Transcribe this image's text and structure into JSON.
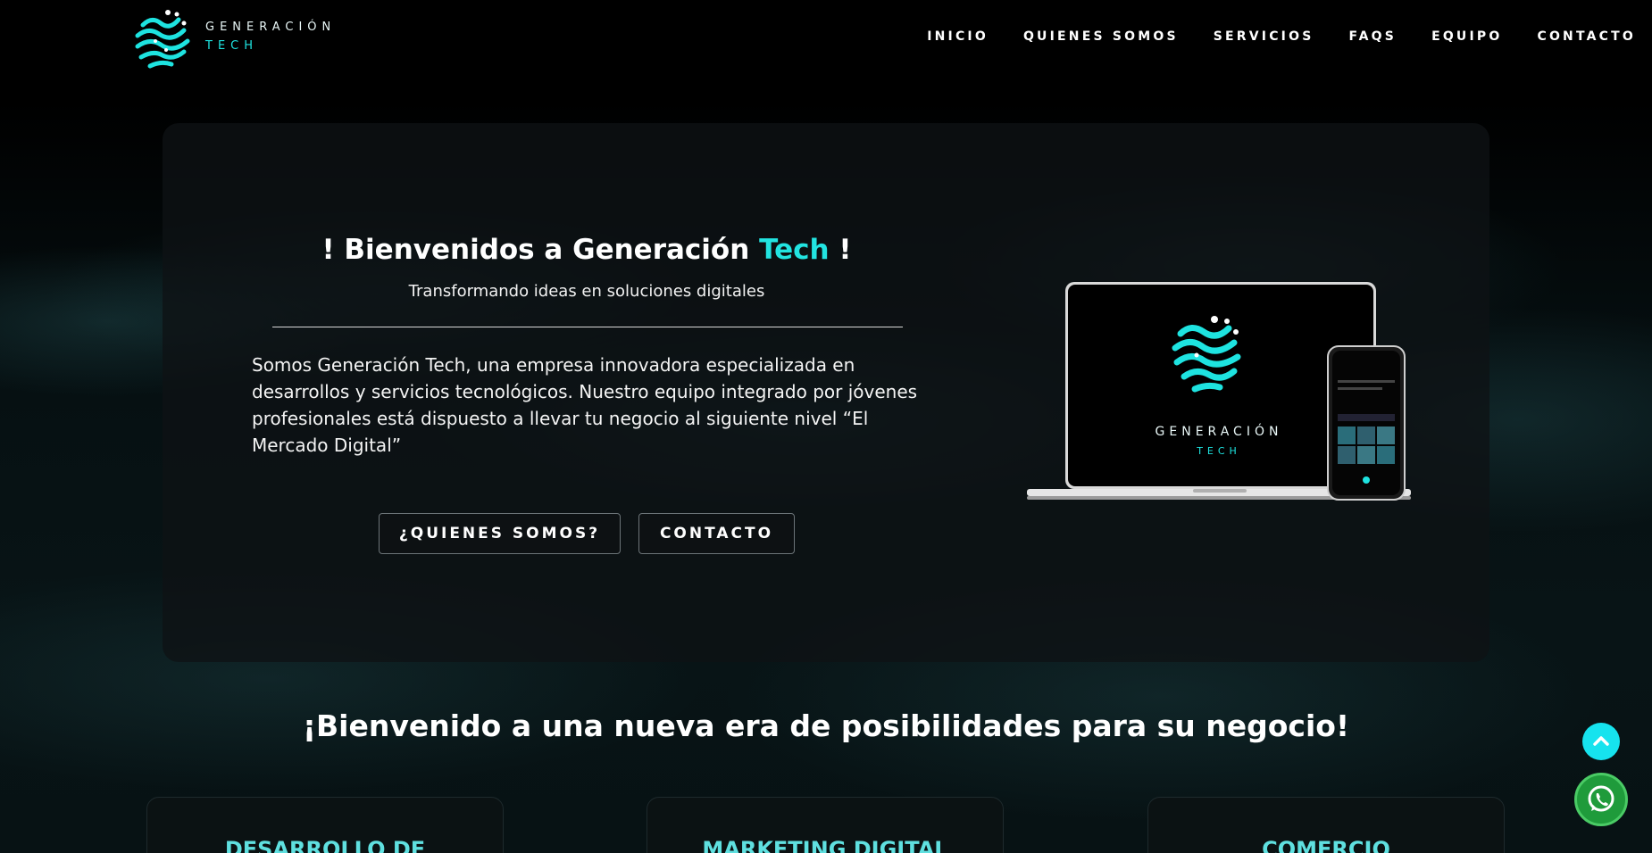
{
  "brand": {
    "line1": "GENERACIÓN",
    "line2": "TECH",
    "accent_color": "#1ee3e0"
  },
  "nav": {
    "items": [
      "INICIO",
      "QUIENES SOMOS",
      "SERVICIOS",
      "FAQS",
      "EQUIPO",
      "CONTACTO"
    ]
  },
  "hero": {
    "title_prefix": "! Bienvenidos a Generación",
    "title_accent": "Tech",
    "title_suffix": "!",
    "subtitle": "Transformando ideas en soluciones digitales",
    "body": "Somos Generación Tech, una empresa innovadora especializada en desarrollos y servicios tecnológicos. Nuestro equipo integrado por jóvenes profesionales está dispuesto a llevar tu negocio al siguiente nivel “El Mercado Digital”",
    "btn_quienes": "¿QUIENES SOMOS?",
    "btn_contacto": "CONTACTO",
    "device_logo_line1": "GENERACIÓN",
    "device_logo_line2": "TECH"
  },
  "section": {
    "title": "¡Bienvenido a una nueva era de posibilidades para su negocio!"
  },
  "services": [
    {
      "title": "DESARROLLO DE"
    },
    {
      "title": "MARKETING DIGITAL"
    },
    {
      "title": "COMERCIO"
    }
  ],
  "icons": {
    "scroll_top": "chevron-up-icon",
    "whatsapp": "whatsapp-icon"
  }
}
